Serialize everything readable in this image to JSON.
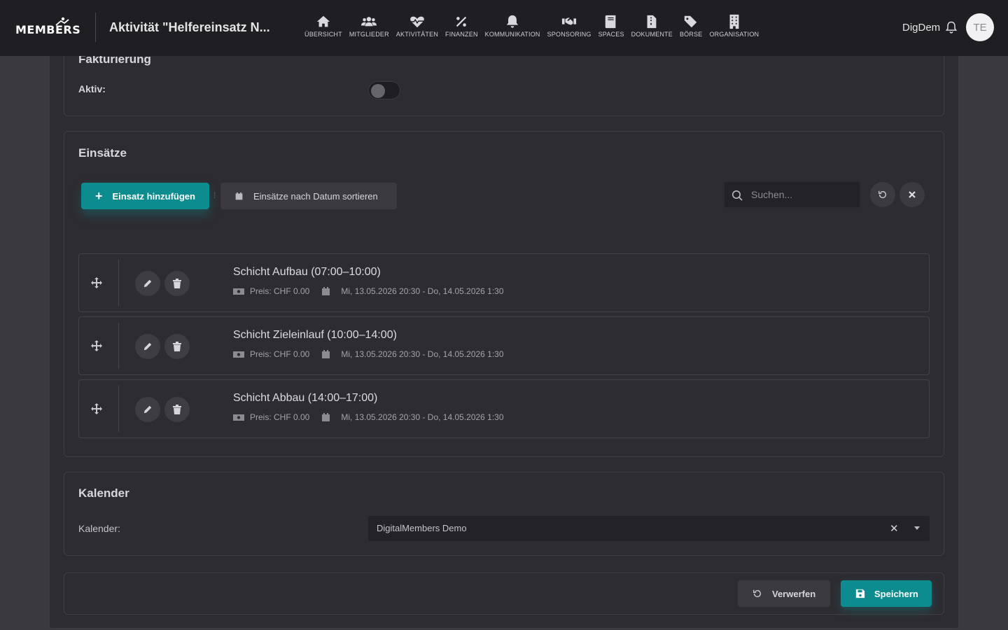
{
  "header": {
    "logo_text": "MEMBERS",
    "page_title": "Aktivität \"Helfereinsatz N...",
    "nav": [
      {
        "label": "ÜBERSICHT",
        "icon": "home-icon"
      },
      {
        "label": "MITGLIEDER",
        "icon": "users-icon"
      },
      {
        "label": "AKTIVITÄTEN",
        "icon": "heartbeat-icon"
      },
      {
        "label": "FINANZEN",
        "icon": "percent-icon"
      },
      {
        "label": "KOMMUNIKATION",
        "icon": "bell-icon"
      },
      {
        "label": "SPONSORING",
        "icon": "handshake-icon"
      },
      {
        "label": "SPACES",
        "icon": "book-icon"
      },
      {
        "label": "DOKUMENTE",
        "icon": "file-zip-icon"
      },
      {
        "label": "BÖRSE",
        "icon": "tags-icon"
      },
      {
        "label": "ORGANISATION",
        "icon": "building-icon"
      }
    ],
    "user_name": "DigDem",
    "avatar_initials": "TE"
  },
  "fakturierung": {
    "title": "Fakturierung",
    "aktiv_label": "Aktiv:",
    "aktiv_value": false
  },
  "einsaetze": {
    "title": "Einsätze",
    "add_label": "Einsatz hinzufügen",
    "sort_label": "Einsätze nach Datum sortieren",
    "search_placeholder": "Suchen...",
    "items": [
      {
        "title": "Schicht Aufbau (07:00–10:00)",
        "price": "Preis: CHF 0.00",
        "date": "Mi, 13.05.2026 20:30 - Do, 14.05.2026 1:30"
      },
      {
        "title": "Schicht Zieleinlauf (10:00–14:00)",
        "price": "Preis: CHF 0.00",
        "date": "Mi, 13.05.2026 20:30 - Do, 14.05.2026 1:30"
      },
      {
        "title": "Schicht Abbau (14:00–17:00)",
        "price": "Preis: CHF 0.00",
        "date": "Mi, 13.05.2026 20:30 - Do, 14.05.2026 1:30"
      }
    ]
  },
  "kalender": {
    "title": "Kalender",
    "label": "Kalender:",
    "value": "DigitalMembers Demo"
  },
  "actions": {
    "discard_label": "Verwerfen",
    "save_label": "Speichern"
  },
  "colors": {
    "accent": "#0c8c8e",
    "topbar": "#1f1e22",
    "card": "#2d2c31"
  }
}
